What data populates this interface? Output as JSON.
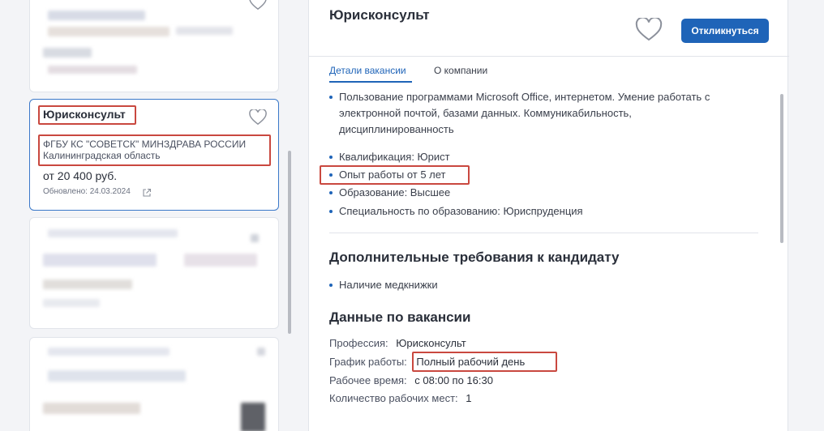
{
  "list": {
    "active_card": {
      "title": "Юрисконсульт",
      "employer": "ФГБУ КС \"СОВЕТСК\" МИНЗДРАВА РОССИИ",
      "region": "Калининградская область",
      "salary": "от 20 400 руб.",
      "updated": "Обновлено: 24.03.2024"
    }
  },
  "vacancy": {
    "title": "Юрисконсульт",
    "respond_label": "Откликнуться",
    "tabs": [
      {
        "label": "Детали вакансии"
      },
      {
        "label": "О компании"
      }
    ],
    "requirements": [
      "Пользование программами Microsoft Office, интернетом. Умение работать с",
      "электронной почтой, базами данных. Коммуникабильность,",
      "дисциплинированность"
    ],
    "details": [
      "Квалификация: Юрист",
      "Опыт работы от 5 лет",
      "Образование: Высшее",
      "Специальность по образованию: Юриспруденция"
    ],
    "extra_heading": "Дополнительные требования к кандидату",
    "extra_items": [
      "Наличие медкнижки"
    ],
    "data_heading": "Данные по вакансии",
    "data_rows": [
      {
        "k": "Профессия:",
        "v": "Юрисконсульт"
      },
      {
        "k": "График работы:",
        "v": "Полный рабочий день"
      },
      {
        "k": "Рабочее время:",
        "v": "с 08:00 по 16:30"
      },
      {
        "k": "Количество рабочих мест:",
        "v": "1"
      }
    ]
  },
  "colors": {
    "accent": "#1f64b8",
    "highlight": "#c9483f"
  }
}
